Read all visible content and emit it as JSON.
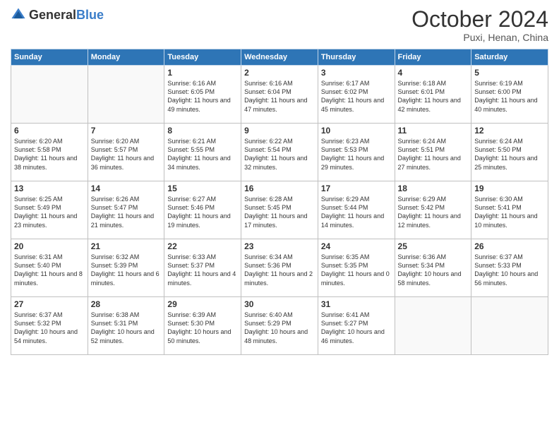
{
  "logo": {
    "general": "General",
    "blue": "Blue"
  },
  "header": {
    "month": "October 2024",
    "location": "Puxi, Henan, China"
  },
  "weekdays": [
    "Sunday",
    "Monday",
    "Tuesday",
    "Wednesday",
    "Thursday",
    "Friday",
    "Saturday"
  ],
  "weeks": [
    [
      {
        "day": "",
        "info": ""
      },
      {
        "day": "",
        "info": ""
      },
      {
        "day": "1",
        "info": "Sunrise: 6:16 AM\nSunset: 6:05 PM\nDaylight: 11 hours and 49 minutes."
      },
      {
        "day": "2",
        "info": "Sunrise: 6:16 AM\nSunset: 6:04 PM\nDaylight: 11 hours and 47 minutes."
      },
      {
        "day": "3",
        "info": "Sunrise: 6:17 AM\nSunset: 6:02 PM\nDaylight: 11 hours and 45 minutes."
      },
      {
        "day": "4",
        "info": "Sunrise: 6:18 AM\nSunset: 6:01 PM\nDaylight: 11 hours and 42 minutes."
      },
      {
        "day": "5",
        "info": "Sunrise: 6:19 AM\nSunset: 6:00 PM\nDaylight: 11 hours and 40 minutes."
      }
    ],
    [
      {
        "day": "6",
        "info": "Sunrise: 6:20 AM\nSunset: 5:58 PM\nDaylight: 11 hours and 38 minutes."
      },
      {
        "day": "7",
        "info": "Sunrise: 6:20 AM\nSunset: 5:57 PM\nDaylight: 11 hours and 36 minutes."
      },
      {
        "day": "8",
        "info": "Sunrise: 6:21 AM\nSunset: 5:55 PM\nDaylight: 11 hours and 34 minutes."
      },
      {
        "day": "9",
        "info": "Sunrise: 6:22 AM\nSunset: 5:54 PM\nDaylight: 11 hours and 32 minutes."
      },
      {
        "day": "10",
        "info": "Sunrise: 6:23 AM\nSunset: 5:53 PM\nDaylight: 11 hours and 29 minutes."
      },
      {
        "day": "11",
        "info": "Sunrise: 6:24 AM\nSunset: 5:51 PM\nDaylight: 11 hours and 27 minutes."
      },
      {
        "day": "12",
        "info": "Sunrise: 6:24 AM\nSunset: 5:50 PM\nDaylight: 11 hours and 25 minutes."
      }
    ],
    [
      {
        "day": "13",
        "info": "Sunrise: 6:25 AM\nSunset: 5:49 PM\nDaylight: 11 hours and 23 minutes."
      },
      {
        "day": "14",
        "info": "Sunrise: 6:26 AM\nSunset: 5:47 PM\nDaylight: 11 hours and 21 minutes."
      },
      {
        "day": "15",
        "info": "Sunrise: 6:27 AM\nSunset: 5:46 PM\nDaylight: 11 hours and 19 minutes."
      },
      {
        "day": "16",
        "info": "Sunrise: 6:28 AM\nSunset: 5:45 PM\nDaylight: 11 hours and 17 minutes."
      },
      {
        "day": "17",
        "info": "Sunrise: 6:29 AM\nSunset: 5:44 PM\nDaylight: 11 hours and 14 minutes."
      },
      {
        "day": "18",
        "info": "Sunrise: 6:29 AM\nSunset: 5:42 PM\nDaylight: 11 hours and 12 minutes."
      },
      {
        "day": "19",
        "info": "Sunrise: 6:30 AM\nSunset: 5:41 PM\nDaylight: 11 hours and 10 minutes."
      }
    ],
    [
      {
        "day": "20",
        "info": "Sunrise: 6:31 AM\nSunset: 5:40 PM\nDaylight: 11 hours and 8 minutes."
      },
      {
        "day": "21",
        "info": "Sunrise: 6:32 AM\nSunset: 5:39 PM\nDaylight: 11 hours and 6 minutes."
      },
      {
        "day": "22",
        "info": "Sunrise: 6:33 AM\nSunset: 5:37 PM\nDaylight: 11 hours and 4 minutes."
      },
      {
        "day": "23",
        "info": "Sunrise: 6:34 AM\nSunset: 5:36 PM\nDaylight: 11 hours and 2 minutes."
      },
      {
        "day": "24",
        "info": "Sunrise: 6:35 AM\nSunset: 5:35 PM\nDaylight: 11 hours and 0 minutes."
      },
      {
        "day": "25",
        "info": "Sunrise: 6:36 AM\nSunset: 5:34 PM\nDaylight: 10 hours and 58 minutes."
      },
      {
        "day": "26",
        "info": "Sunrise: 6:37 AM\nSunset: 5:33 PM\nDaylight: 10 hours and 56 minutes."
      }
    ],
    [
      {
        "day": "27",
        "info": "Sunrise: 6:37 AM\nSunset: 5:32 PM\nDaylight: 10 hours and 54 minutes."
      },
      {
        "day": "28",
        "info": "Sunrise: 6:38 AM\nSunset: 5:31 PM\nDaylight: 10 hours and 52 minutes."
      },
      {
        "day": "29",
        "info": "Sunrise: 6:39 AM\nSunset: 5:30 PM\nDaylight: 10 hours and 50 minutes."
      },
      {
        "day": "30",
        "info": "Sunrise: 6:40 AM\nSunset: 5:29 PM\nDaylight: 10 hours and 48 minutes."
      },
      {
        "day": "31",
        "info": "Sunrise: 6:41 AM\nSunset: 5:27 PM\nDaylight: 10 hours and 46 minutes."
      },
      {
        "day": "",
        "info": ""
      },
      {
        "day": "",
        "info": ""
      }
    ]
  ]
}
